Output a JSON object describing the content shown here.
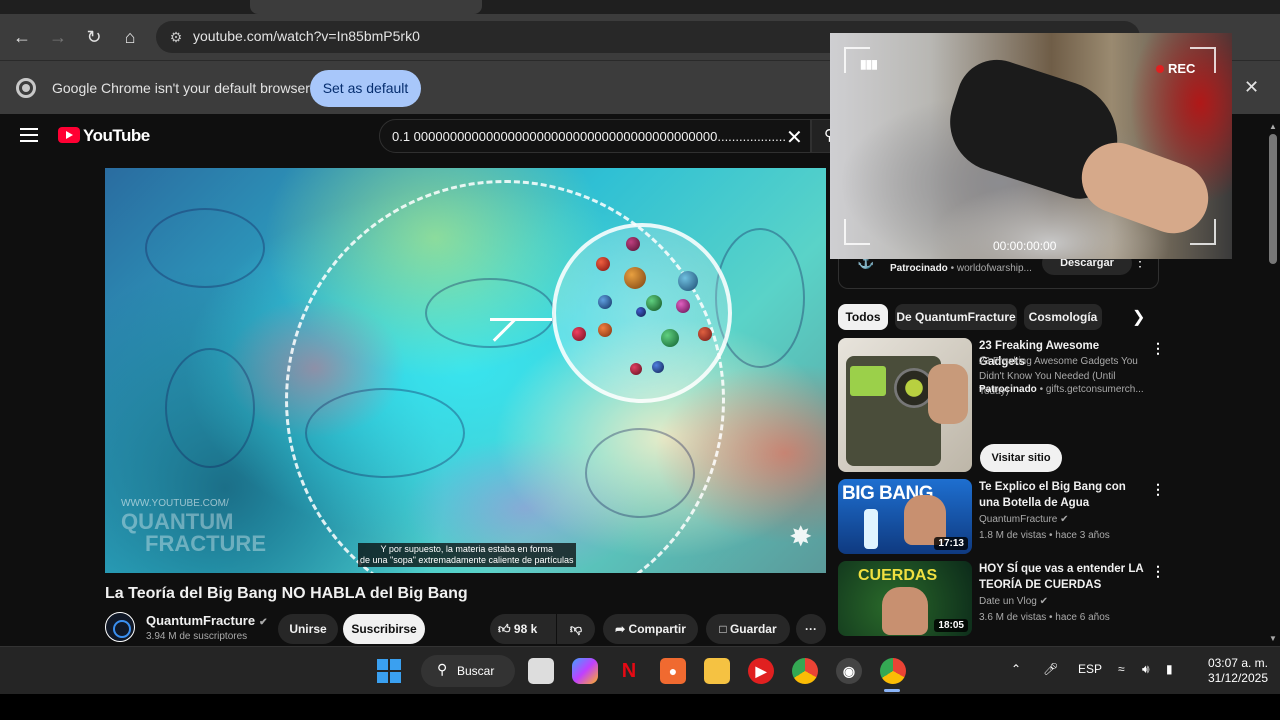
{
  "browser": {
    "url": "youtube.com/watch?v=In85bmP5rk0",
    "infobar_message": "Google Chrome isn't your default browser",
    "infobar_button": "Set as default",
    "nav_icons": [
      "back-icon",
      "forward-icon",
      "reload-icon",
      "home-icon"
    ]
  },
  "youtube": {
    "logo_text": "YouTube",
    "search_query": "0.1 000000000000000000000000000000000000000000.....................",
    "video": {
      "watermark_small": "WWW.YOUTUBE.COM/",
      "watermark_large_1": "QUANTUM",
      "watermark_large_2": "FRACTURE",
      "subtitle_line1": "Y por supuesto, la materia estaba en forma",
      "subtitle_line2": "de una \"sopa\" extremadamente caliente de partículas",
      "title": "La Teoría del Big Bang NO HABLA del Big Bang"
    },
    "channel": {
      "name": "QuantumFracture",
      "verified_icon": "✔",
      "subscribers": "3.94 M de suscriptores",
      "join_label": "Unirse",
      "subscribe_label": "Suscribirse"
    },
    "actions": {
      "likes": "98 k",
      "share": "Compartir",
      "save": "Guardar"
    },
    "sidebar": {
      "top_ad": {
        "sponsored": "Patrocinado",
        "domain": "• worldofwarship...",
        "button": "Descargar"
      },
      "chips": [
        "Todos",
        "De QuantumFracture",
        "Cosmología"
      ],
      "ad": {
        "title": "23 Freaking Awesome Gadgets",
        "description": "23 Freaking Awesome Gadgets You Didn't Know You Needed (Until Today)",
        "sponsored": "Patrocinado",
        "domain": "• gifts.getconsumerch...",
        "button": "Visitar sitio"
      },
      "videos": [
        {
          "title": "Te Explico el Big Bang con una Botella de Agua",
          "thumb_text": "BIG BANG",
          "channel": "QuantumFracture",
          "meta": "1.8 M de vistas • hace 3 años",
          "duration": "17:13"
        },
        {
          "title": "HOY SÍ que vas a entender LA TEORÍA DE CUERDAS",
          "thumb_text": "CUERDAS",
          "channel": "Date un Vlog",
          "meta": "3.6 M de vistas • hace 6 años",
          "duration": "18:05"
        }
      ]
    }
  },
  "cam_overlay": {
    "rec": "REC",
    "timecode": "00:00:00:00"
  },
  "taskbar": {
    "search_label": "Buscar",
    "language": "ESP",
    "time": "03:07 a. m.",
    "date": "31/12/2025"
  }
}
